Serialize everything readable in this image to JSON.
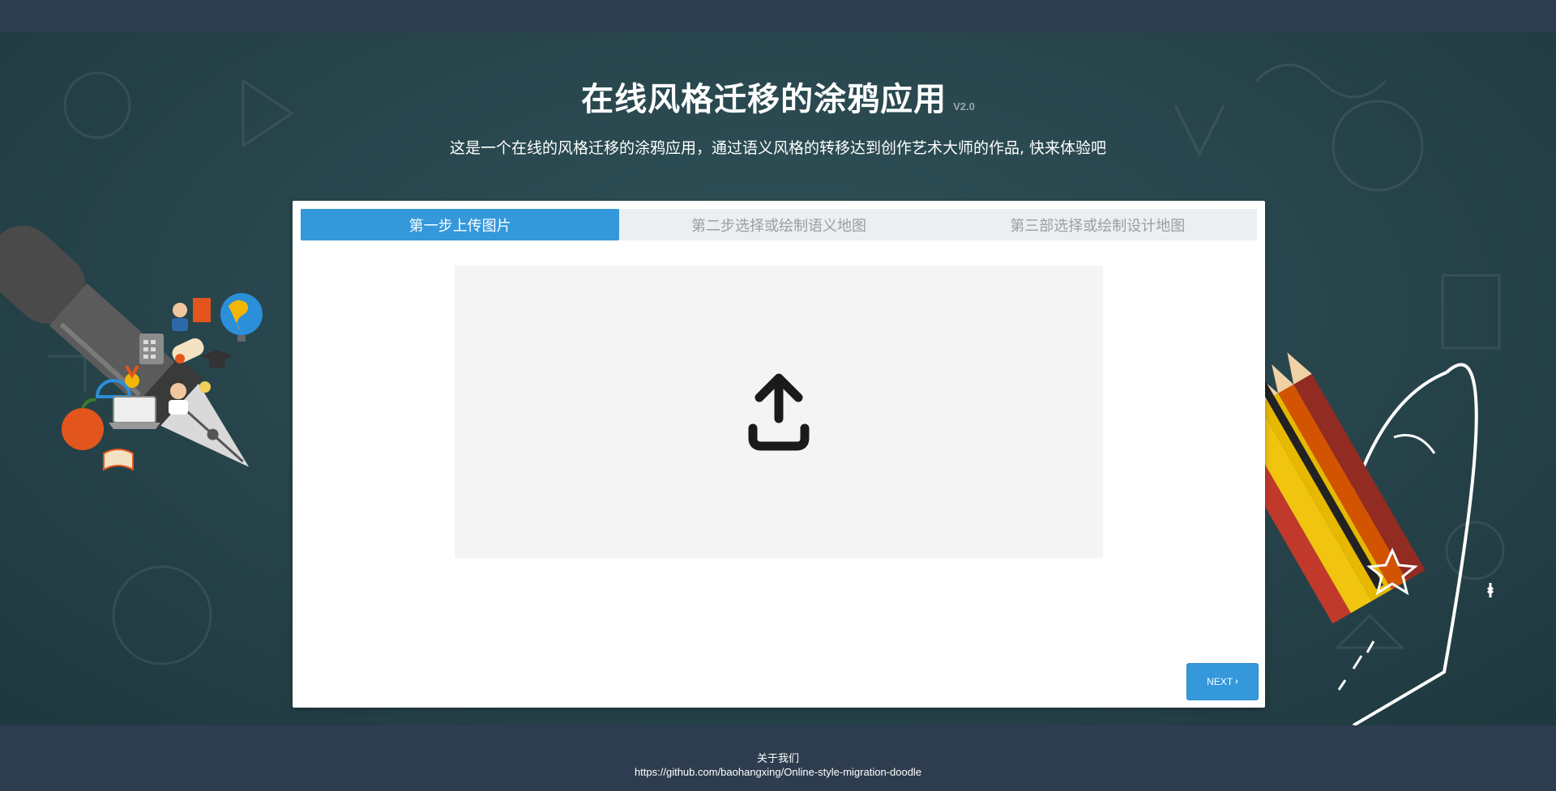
{
  "header": {
    "title": "在线风格迁移的涂鸦应用",
    "version": "V2.0",
    "subtitle": "这是一个在线的风格迁移的涂鸦应用，通过语义风格的转移达到创作艺术大师的作品, 快来体验吧"
  },
  "wizard": {
    "steps": [
      {
        "label": "第一步上传图片",
        "active": true
      },
      {
        "label": "第二步选择或绘制语义地图",
        "active": false
      },
      {
        "label": "第三部选择或绘制设计地图",
        "active": false
      }
    ],
    "upload_icon": "upload-icon",
    "next_label": "NEXT",
    "next_icon": "chevron-right-icon"
  },
  "footer": {
    "about": "关于我们",
    "link": "https://github.com/baohangxing/Online-style-migration-doodle"
  },
  "colors": {
    "accent": "#3498db",
    "hero_bg": "#27444b",
    "bar_bg": "#2d3d4f",
    "dropzone_bg": "#f4f4f4"
  }
}
